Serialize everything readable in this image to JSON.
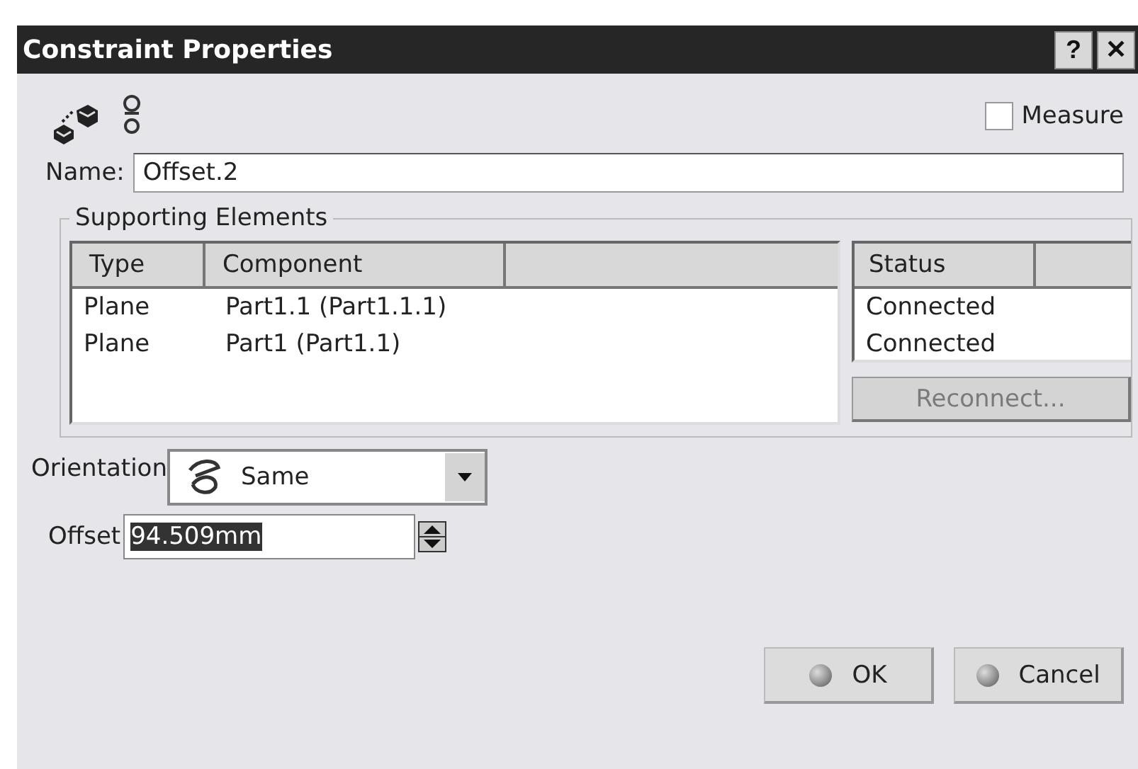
{
  "window": {
    "title": "Constraint Properties",
    "buttons": [
      "?",
      "✕"
    ]
  },
  "measure": {
    "label": "Measure",
    "checked": false
  },
  "name": {
    "label": "Name:",
    "value": "Offset.2"
  },
  "supporting_elements": {
    "title": "Supporting Elements",
    "columns": [
      "Type",
      "Component"
    ],
    "rows": [
      [
        "Plane",
        "Part1.1 (Part1.1.1)"
      ],
      [
        "Plane",
        "Part1 (Part1.1)"
      ]
    ],
    "status_column": "Status",
    "statuses": [
      "Connected",
      "Connected"
    ],
    "reconnect": {
      "label": "Reconnect...",
      "disabled": true
    }
  },
  "orientation": {
    "label": "Orientation",
    "value": "Same"
  },
  "offset": {
    "label": "Offset",
    "value": "94.509mm",
    "selected": true
  },
  "buttons": [
    "OK",
    "Cancel"
  ]
}
